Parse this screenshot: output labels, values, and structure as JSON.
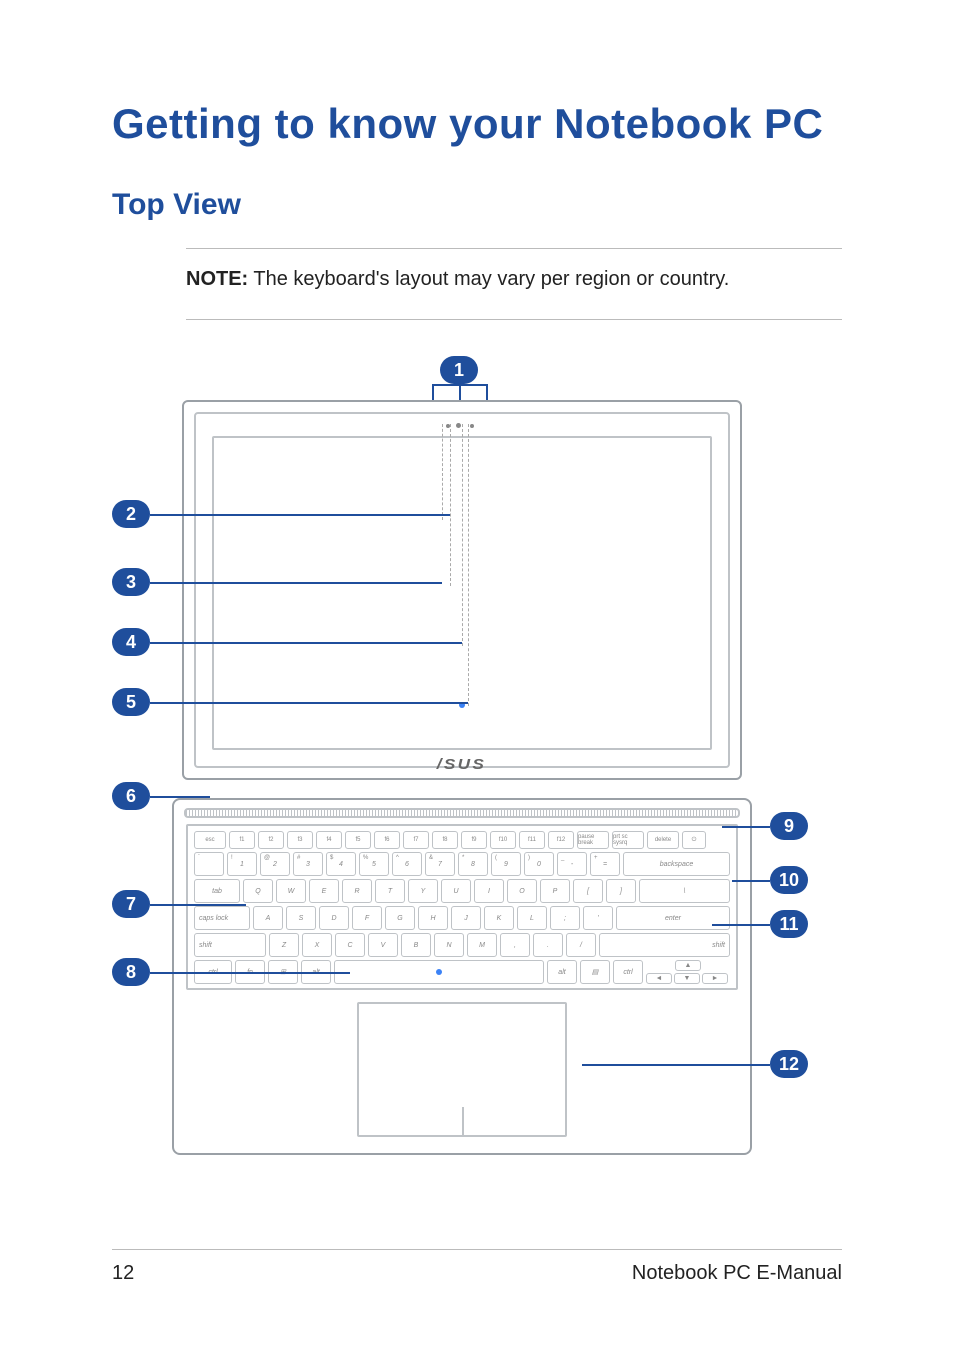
{
  "headings": {
    "title": "Getting to know your Notebook PC",
    "subtitle": "Top View"
  },
  "note": {
    "label": "NOTE:",
    "text": " The keyboard's layout may vary per region or country."
  },
  "brand": "/SUS",
  "callouts": {
    "c1": "1",
    "c2": "2",
    "c3": "3",
    "c4": "4",
    "c5": "5",
    "c6": "6",
    "c7": "7",
    "c8": "8",
    "c9": "9",
    "c10": "10",
    "c11": "11",
    "c12": "12"
  },
  "keyboard": {
    "fn_row": [
      "esc",
      "f1",
      "f2",
      "f3",
      "f4",
      "f5",
      "f6",
      "f7",
      "f8",
      "f9",
      "f10",
      "f11",
      "f12",
      "pause break",
      "prt sc sysrq",
      "delete",
      "⏻"
    ],
    "num_row_upper": [
      "`",
      "!",
      "@",
      "#",
      "$",
      "%",
      "^",
      "&",
      "*",
      "(",
      ")",
      "_",
      "+"
    ],
    "num_row_lower": [
      "",
      "1",
      "2",
      "3",
      "4",
      "5",
      "6",
      "7",
      "8",
      "9",
      "0",
      "-",
      "="
    ],
    "backspace": "backspace",
    "tab": "tab",
    "row_q": [
      "Q",
      "W",
      "E",
      "R",
      "T",
      "Y",
      "U",
      "I",
      "O",
      "P",
      "[",
      "]",
      "\\"
    ],
    "caps": "caps lock",
    "row_a": [
      "A",
      "S",
      "D",
      "F",
      "G",
      "H",
      "J",
      "K",
      "L",
      ";",
      "'"
    ],
    "enter": "enter",
    "lshift": "shift",
    "row_z": [
      "Z",
      "X",
      "C",
      "V",
      "B",
      "N",
      "M",
      ",",
      ".",
      "/"
    ],
    "rshift": "shift",
    "bottom": [
      "ctrl",
      "fn",
      "⊞",
      "alt",
      "",
      "alt",
      "▤",
      "ctrl"
    ],
    "arrows": {
      "up": "▲",
      "left": "◄",
      "down": "▼",
      "right": "►"
    }
  },
  "footer": {
    "page": "12",
    "title": "Notebook PC E-Manual"
  }
}
